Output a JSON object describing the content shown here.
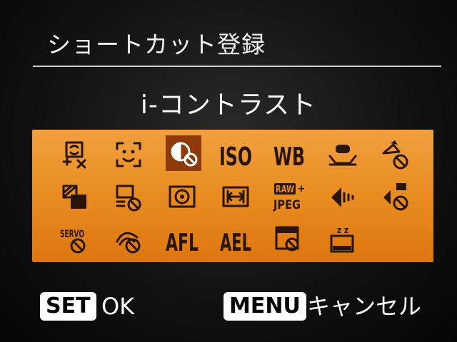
{
  "header": {
    "title": "ショートカット登録"
  },
  "selection": {
    "name": "i-コントラスト"
  },
  "grid": {
    "rows": [
      [
        {
          "icon": "face-select-off-icon"
        },
        {
          "icon": "face-detect-frame-icon"
        },
        {
          "icon": "i-contrast-off-icon",
          "selected": true
        },
        {
          "icon": "iso-icon",
          "label": "ISO"
        },
        {
          "icon": "white-balance-icon",
          "label": "WB"
        },
        {
          "icon": "servo-af-icon"
        },
        {
          "icon": "shadow-correct-off-icon"
        }
      ],
      [
        {
          "icon": "aspect-ratio-icon"
        },
        {
          "icon": "display-off-icon"
        },
        {
          "icon": "metering-icon"
        },
        {
          "icon": "af-frame-size-icon"
        },
        {
          "icon": "raw-jpeg-icon",
          "label_top": "RAW",
          "label_bottom": "JPEG"
        },
        {
          "icon": "flash-exposure-icon"
        },
        {
          "icon": "flash-off-icon"
        }
      ],
      [
        {
          "icon": "servo-off-icon",
          "label": "SERVO"
        },
        {
          "icon": "image-stabilizer-off-icon"
        },
        {
          "icon": "af-lock-icon",
          "label": "AFL"
        },
        {
          "icon": "ae-lock-icon",
          "label": "AEL"
        },
        {
          "icon": "lcd-off-icon"
        },
        {
          "icon": "sleep-icon",
          "label": "z z"
        }
      ]
    ]
  },
  "footer": {
    "set_key": "SET",
    "set_label": "OK",
    "menu_key": "MENU",
    "menu_label": "キャンセル"
  },
  "colors": {
    "panel_orange": "#e88c20",
    "selected_cell": "#8b3a08",
    "icon_ink": "#2a1404"
  }
}
